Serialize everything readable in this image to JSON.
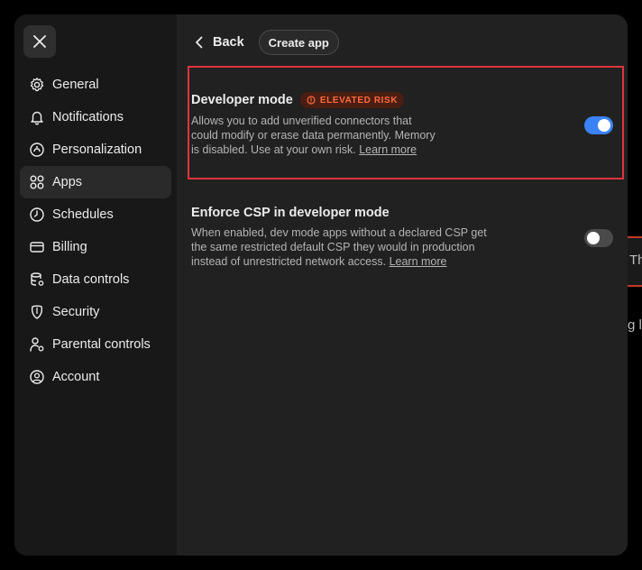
{
  "backdrop": {
    "fragment_text": "Th",
    "fragment_text_2": "g l"
  },
  "sidebar": {
    "items": [
      {
        "label": "General",
        "icon": "gear-icon"
      },
      {
        "label": "Notifications",
        "icon": "bell-icon"
      },
      {
        "label": "Personalization",
        "icon": "personalization-icon"
      },
      {
        "label": "Apps",
        "icon": "apps-grid-icon",
        "active": true
      },
      {
        "label": "Schedules",
        "icon": "clock-icon"
      },
      {
        "label": "Billing",
        "icon": "credit-card-icon"
      },
      {
        "label": "Data controls",
        "icon": "database-icon"
      },
      {
        "label": "Security",
        "icon": "shield-icon"
      },
      {
        "label": "Parental controls",
        "icon": "parental-icon"
      },
      {
        "label": "Account",
        "icon": "account-icon"
      }
    ]
  },
  "topbar": {
    "back_label": "Back",
    "create_label": "Create app"
  },
  "settings": {
    "developer_mode": {
      "title": "Developer mode",
      "badge": "ELEVATED RISK",
      "desc_line1": "Allows you to add unverified connectors that",
      "desc_line2": "could modify or erase data permanently. Memory",
      "desc_line3": "is disabled. Use at your own risk.",
      "link": "Learn more",
      "enabled": true
    },
    "enforce_csp": {
      "title": "Enforce CSP in developer mode",
      "desc_line1": "When enabled, dev mode apps without a declared CSP get",
      "desc_line2": "the same restricted default CSP they would in production",
      "desc_line3": "instead of unrestricted network access.",
      "link": "Learn more",
      "enabled": false
    }
  },
  "colors": {
    "accent": "#3b82f6",
    "risk": "#ff6a3d",
    "highlight": "#e0343f"
  }
}
